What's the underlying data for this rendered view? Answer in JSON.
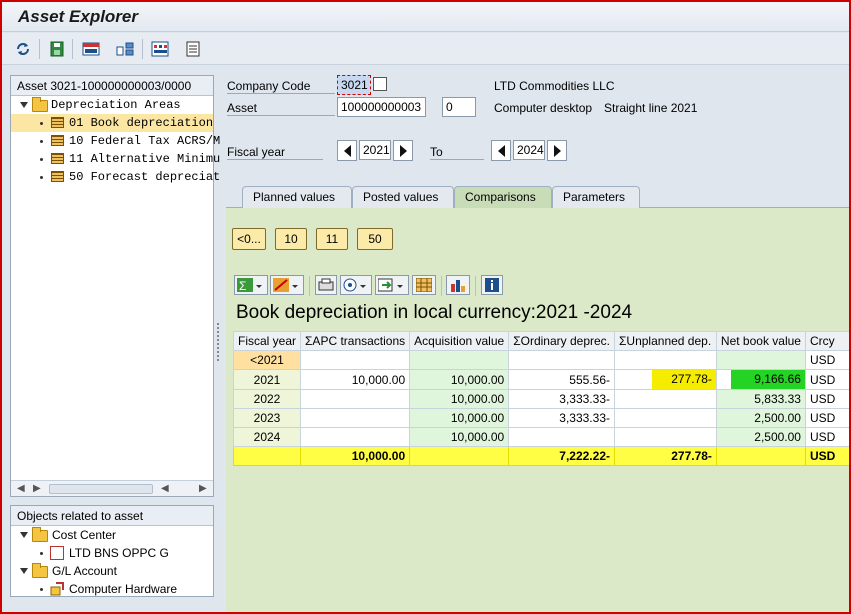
{
  "window": {
    "title": "Asset Explorer"
  },
  "toolbar": {
    "icons": [
      "refresh-icon",
      "save-icon",
      "print-icon",
      "structure-icon",
      "list-icon",
      "info-icon"
    ]
  },
  "left_tree": {
    "header": "Asset 3021-100000000003/0000",
    "root": "Depreciation Areas",
    "items": [
      {
        "label": "01 Book depreciation"
      },
      {
        "label": "10 Federal Tax ACRS/M"
      },
      {
        "label": "11 Alternative Minimu"
      },
      {
        "label": "50 Forecast depreciat"
      }
    ]
  },
  "related": {
    "header": "Objects related to asset",
    "cost_center": {
      "label": "Cost Center",
      "item": "LTD BNS OPPC G"
    },
    "gl_account": {
      "label": "G/L Account",
      "item": "Computer Hardware"
    }
  },
  "header_fields": {
    "company_code_label": "Company Code",
    "company_code": "3021",
    "company_name": "LTD Commodities LLC",
    "asset_label": "Asset",
    "asset_number": "100000000003",
    "asset_sub": "0",
    "asset_desc": "Computer desktop",
    "asset_method": "Straight line 2021",
    "fiscal_year_label": "Fiscal year",
    "fiscal_from": "2021",
    "to_label": "To",
    "fiscal_to": "2024"
  },
  "tabs": [
    {
      "label": "Planned values"
    },
    {
      "label": "Posted values"
    },
    {
      "label": "Comparisons",
      "active": true
    },
    {
      "label": "Parameters"
    }
  ],
  "area_buttons": [
    "<0...",
    "10",
    "11",
    "50"
  ],
  "grid": {
    "title": "Book depreciation in local currency:2021 -2024",
    "headers": [
      "Fiscal year",
      "ΣAPC transactions",
      "Acquisition value",
      "ΣOrdinary deprec.",
      "ΣUnplanned dep.",
      "Net book value",
      "Crcy"
    ],
    "rows": [
      [
        "<2021",
        "",
        "",
        "",
        "",
        "",
        "USD"
      ],
      [
        "2021",
        "10,000.00",
        "10,000.00",
        "555.56-",
        "277.78-",
        "9,166.66",
        "USD"
      ],
      [
        "2022",
        "",
        "10,000.00",
        "3,333.33-",
        "",
        "5,833.33",
        "USD"
      ],
      [
        "2023",
        "",
        "10,000.00",
        "3,333.33-",
        "",
        "2,500.00",
        "USD"
      ],
      [
        "2024",
        "",
        "10,000.00",
        "",
        "",
        "2,500.00",
        "USD"
      ]
    ],
    "total": [
      "",
      "10,000.00",
      "",
      "7,222.22-",
      "277.78-",
      "",
      "USD"
    ]
  },
  "colors": {
    "frame": "#d00000",
    "tab_active": "#c8dcb7",
    "total_row": "#fffe44",
    "unplanned_highlight": "#f5ec00",
    "nbv_highlight": "#25d325"
  }
}
